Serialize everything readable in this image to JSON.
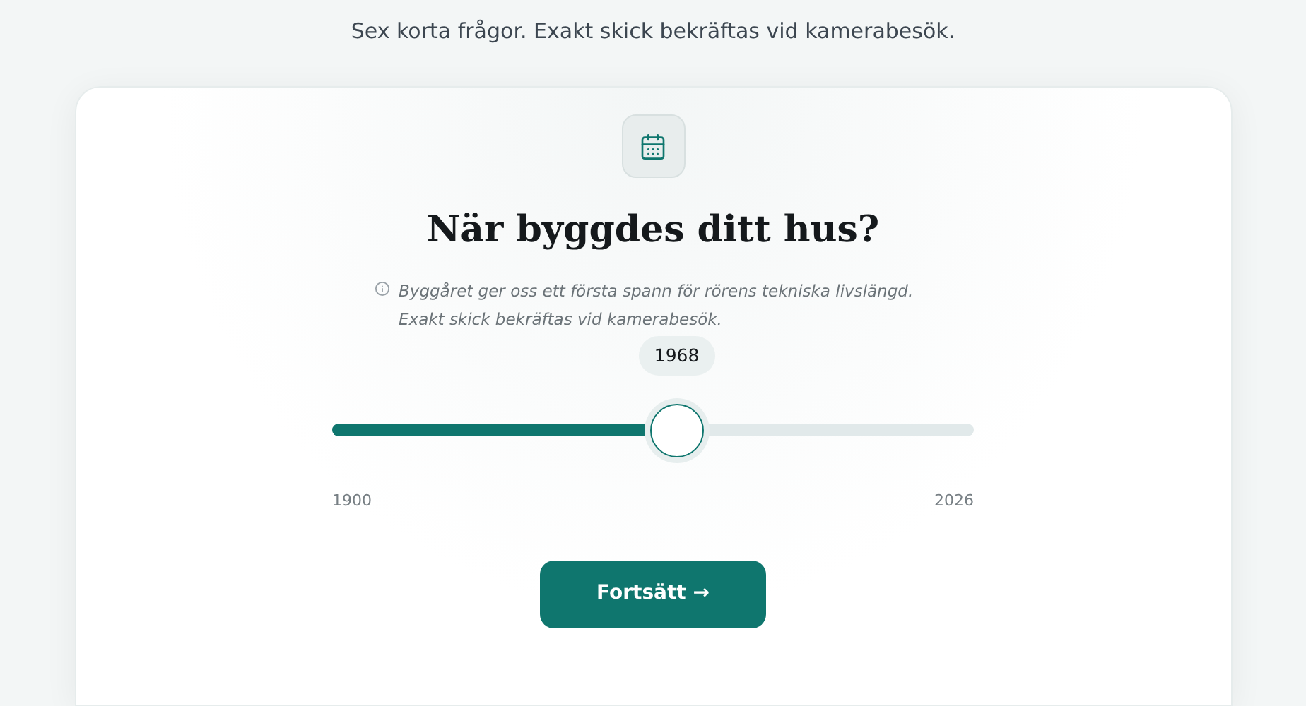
{
  "subtitle": "Sex korta frågor. Exakt skick bekräftas vid kamerabesök.",
  "question": {
    "title": "När byggdes ditt hus?",
    "note": [
      "Byggåret ger oss ett första spann för rörens tekniska livslängd.",
      "Exakt skick bekräftas vid kamerabesök."
    ]
  },
  "slider": {
    "value": "1968",
    "level": 0.537,
    "min_label": "1900",
    "max_label": "2026"
  },
  "continue_button": {
    "label": "Fortsätt →"
  }
}
